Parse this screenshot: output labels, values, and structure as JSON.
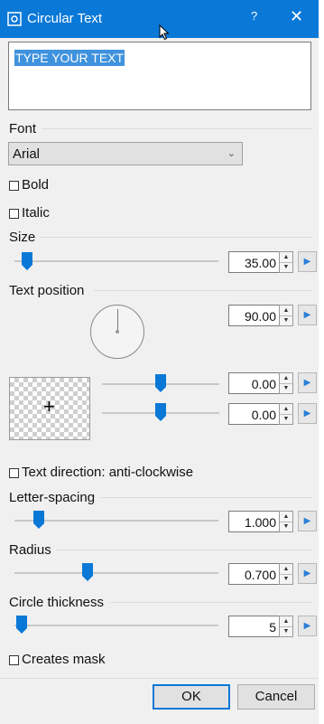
{
  "window": {
    "title": "Circular Text",
    "help_glyph": "?",
    "close_glyph": "✕",
    "app_icon": "gear-icon"
  },
  "text_input": {
    "value": "TYPE YOUR TEXT"
  },
  "font": {
    "label": "Font",
    "selected": "Arial"
  },
  "bold": {
    "label": "Bold",
    "checked": false
  },
  "italic": {
    "label": "Italic",
    "checked": false
  },
  "size": {
    "label": "Size",
    "value": "35.00",
    "slider_fraction": 0.05
  },
  "text_position": {
    "label": "Text position",
    "angle": "90.00",
    "offset_x": "0.00",
    "offset_y": "0.00",
    "offset_x_slider": 0.5,
    "offset_y_slider": 0.5
  },
  "text_direction": {
    "label": "Text direction: anti-clockwise",
    "checked": false
  },
  "letter_spacing": {
    "label": "Letter-spacing",
    "value": "1.000",
    "slider_fraction": 0.12
  },
  "radius": {
    "label": "Radius",
    "value": "0.700",
    "slider_fraction": 0.35
  },
  "circle_thickness": {
    "label": "Circle thickness",
    "value": "5",
    "slider_fraction": 0.0
  },
  "creates_mask": {
    "label": "Creates mask",
    "checked": false
  },
  "buttons": {
    "ok": "OK",
    "cancel": "Cancel"
  },
  "colors": {
    "accent": "#0a78d7",
    "selection": "#3f92dd"
  }
}
